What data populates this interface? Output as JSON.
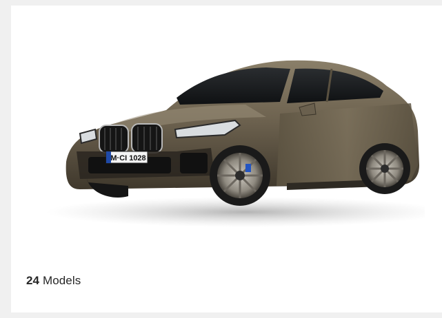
{
  "card": {
    "model_count": "24",
    "models_label": "Models",
    "license_plate": "M·CI 1028"
  },
  "colors": {
    "page_bg": "#f0f0f0",
    "card_bg": "#ffffff",
    "car_paint": "#6e6350",
    "text": "#262626"
  }
}
